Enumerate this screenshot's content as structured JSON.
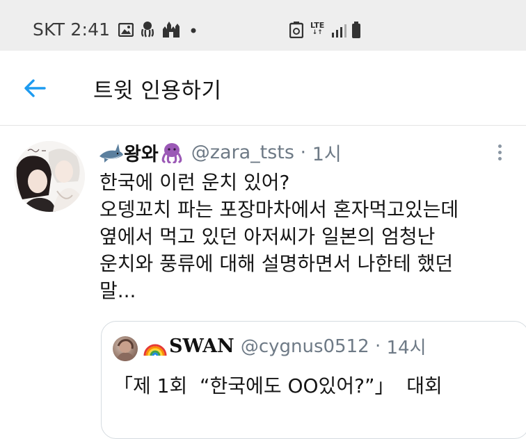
{
  "status_bar": {
    "time": "SKT 2:41",
    "network": "LTE",
    "icons": [
      "image-icon",
      "octopus-icon",
      "castle-icon",
      "dot-icon",
      "recycle-icon",
      "lte-icon",
      "signal-icon",
      "battery-icon"
    ]
  },
  "header": {
    "back_icon": "back-arrow-icon",
    "title": "트윗 인용하기"
  },
  "tweet": {
    "emoji_prefix": "shark-emoji",
    "display_name": "왕와",
    "emoji_suffix": "octopus-emoji",
    "handle": "@zara_tsts",
    "time_label": "1시",
    "lines": [
      "한국에 이런 운치 있어?",
      "오뎅꼬치 파는 포장마차에서 혼자먹고있는데",
      "옆에서 먹고 있던 아저씨가 일본의 엄청난",
      "운치와 풍류에 대해 설명하면서 나한테 했던",
      "말..."
    ]
  },
  "quoted_tweet": {
    "emoji_prefix": "rainbow-emoji",
    "display_name": "SWAN",
    "handle": "@cygnus0512",
    "time_label": "14시",
    "text": "「제 1회  “한국에도 OO있어?”」  대회"
  },
  "colors": {
    "accent": "#1d9bf0",
    "status_bar_bg": "#eeeeee",
    "secondary_text": "#6e7a86",
    "border": "#d5dbe0"
  }
}
